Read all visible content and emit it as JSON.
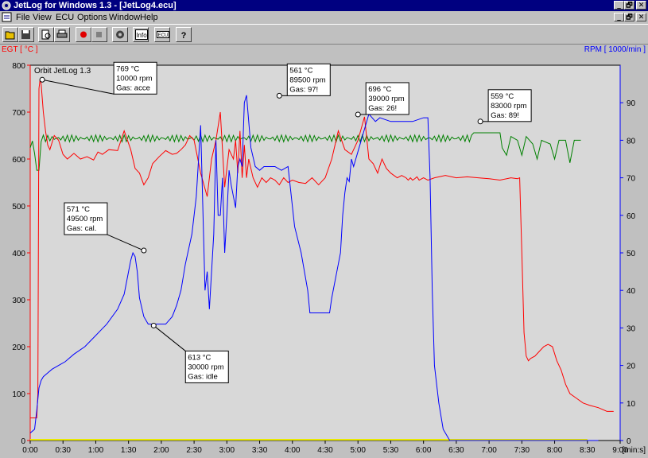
{
  "window": {
    "title": "JetLog for Windows 1.3 - [JetLog4.ecu]",
    "controls": [
      "_",
      "🗗",
      "✕"
    ],
    "doc_controls": [
      "_",
      "🗗",
      "✕"
    ]
  },
  "menu": {
    "items": [
      {
        "label": "File"
      },
      {
        "label": "View"
      },
      {
        "label": "ECU"
      },
      {
        "label": "Options"
      },
      {
        "label": "Window"
      },
      {
        "label": "Help"
      }
    ]
  },
  "toolbar": {
    "buttons": [
      {
        "icon": "open-folder-icon"
      },
      {
        "icon": "save-disk-icon"
      },
      {
        "icon": "print-preview-icon"
      },
      {
        "icon": "print-icon"
      },
      {
        "icon": "record-icon"
      },
      {
        "icon": "stop-icon"
      },
      {
        "icon": "engine-icon"
      },
      {
        "icon": "info-icon",
        "label": "Info"
      },
      {
        "icon": "ecu-icon",
        "label": "ECU"
      },
      {
        "icon": "help-icon",
        "label": "?"
      }
    ]
  },
  "colors": {
    "egt": "#ff0000",
    "rpm": "#0000ff",
    "green": "#008000",
    "yellow": "#e8e800",
    "plot_bg": "#d8d8d8"
  },
  "chart_data": {
    "type": "line",
    "left_axis_label": "EGT [ °C ]",
    "right_axis_label": "RPM [ 1000/min ]",
    "x_unit_label": "[min:s]",
    "logo": "Orbit JetLog 1.3",
    "x_ticks": [
      "0:00",
      "0:30",
      "1:00",
      "1:30",
      "2:00",
      "2:30",
      "3:00",
      "3:30",
      "4:00",
      "4:30",
      "5:00",
      "5:30",
      "6:00",
      "6:30",
      "7:00",
      "7:30",
      "8:00",
      "8:30",
      "9:00"
    ],
    "xlim": [
      0,
      540
    ],
    "ylim_left": [
      0,
      800
    ],
    "ylim_right": [
      0,
      100
    ],
    "left_ticks": [
      "0",
      "100",
      "200",
      "300",
      "400",
      "500",
      "600",
      "700",
      "800"
    ],
    "right_ticks": [
      "0",
      "10",
      "20",
      "30",
      "40",
      "50",
      "60",
      "70",
      "80",
      "90"
    ],
    "series": [
      {
        "axis": "left",
        "x": [
          0,
          6,
          7,
          8,
          9,
          10,
          12,
          14,
          16,
          18,
          22,
          26,
          30,
          34,
          40,
          46,
          52,
          58,
          62,
          66,
          72,
          80,
          86,
          92,
          96,
          100,
          104,
          108,
          112,
          118,
          124,
          130,
          134,
          138,
          142,
          146,
          150,
          156,
          162,
          166,
          170,
          174,
          178,
          182,
          186,
          188,
          190,
          192,
          194,
          196,
          198,
          200,
          204,
          208,
          212,
          216,
          220,
          224,
          228,
          232,
          236,
          240,
          246,
          252,
          258,
          264,
          270,
          276,
          282,
          288,
          294,
          300,
          306,
          310,
          314,
          318,
          322,
          326,
          330,
          336,
          340,
          344,
          346,
          348,
          350,
          352,
          354,
          356,
          360,
          364,
          370,
          380,
          390,
          400,
          410,
          420,
          430,
          440,
          446,
          448,
          450,
          452,
          454,
          456,
          458,
          462,
          466,
          470,
          474,
          478,
          482,
          486,
          490,
          494,
          500,
          506,
          512,
          520,
          528,
          534
        ],
        "y": [
          48,
          48,
          100,
          750,
          769,
          760,
          700,
          660,
          630,
          620,
          650,
          640,
          610,
          600,
          612,
          600,
          605,
          598,
          615,
          610,
          620,
          618,
          660,
          620,
          580,
          570,
          545,
          560,
          590,
          605,
          618,
          610,
          612,
          620,
          630,
          650,
          640,
          570,
          520,
          600,
          640,
          700,
          540,
          620,
          600,
          640,
          570,
          660,
          560,
          630,
          560,
          600,
          560,
          540,
          560,
          550,
          560,
          555,
          545,
          560,
          550,
          555,
          550,
          548,
          560,
          545,
          560,
          600,
          660,
          620,
          610,
          640,
          690,
          600,
          590,
          570,
          600,
          580,
          570,
          560,
          565,
          560,
          555,
          560,
          555,
          558,
          562,
          555,
          560,
          555,
          560,
          565,
          560,
          562,
          560,
          558,
          555,
          560,
          558,
          560,
          400,
          230,
          180,
          170,
          175,
          180,
          190,
          200,
          205,
          200,
          170,
          150,
          120,
          100,
          90,
          80,
          75,
          70,
          62,
          62
        ]
      },
      {
        "axis": "right",
        "x": [
          0,
          4,
          6,
          8,
          10,
          12,
          16,
          20,
          26,
          32,
          40,
          50,
          60,
          70,
          80,
          86,
          90,
          92,
          94,
          96,
          98,
          100,
          104,
          108,
          112,
          116,
          120,
          124,
          130,
          134,
          138,
          142,
          148,
          152,
          156,
          160,
          162,
          164,
          166,
          168,
          170,
          172,
          174,
          176,
          178,
          180,
          182,
          184,
          186,
          188,
          190,
          192,
          194,
          196,
          198,
          200,
          202,
          206,
          210,
          214,
          218,
          224,
          230,
          236,
          242,
          248,
          254,
          256,
          258,
          264,
          270,
          274,
          276,
          280,
          284,
          286,
          288,
          290,
          292,
          294,
          296,
          298,
          300,
          304,
          310,
          316,
          320,
          330,
          340,
          350,
          360,
          364,
          366,
          368,
          370,
          374,
          378,
          382,
          384,
          386,
          390,
          396,
          402,
          408,
          414,
          420,
          426,
          432,
          438,
          444,
          450,
          456,
          460,
          464,
          468,
          472,
          476,
          480,
          484,
          488,
          490,
          492,
          494,
          496,
          498,
          500,
          506,
          512,
          518,
          520
        ],
        "y": [
          2,
          3,
          8,
          14,
          16,
          17,
          18,
          19,
          20,
          21,
          23,
          25,
          28,
          31,
          35,
          39,
          45,
          48,
          50,
          49,
          45,
          38,
          33,
          31,
          31,
          31,
          31,
          31,
          33,
          36,
          40,
          47,
          55,
          65,
          84,
          40,
          45,
          35,
          45,
          55,
          80,
          60,
          60,
          70,
          50,
          60,
          72,
          68,
          65,
          62,
          73,
          75,
          73,
          90,
          92,
          85,
          78,
          73,
          72,
          73,
          73,
          73,
          72,
          73,
          57,
          50,
          40,
          34,
          34,
          34,
          34,
          34,
          38,
          44,
          50,
          60,
          66,
          70,
          69,
          75,
          73,
          75,
          77,
          81,
          87,
          85,
          86,
          85,
          85,
          85,
          86,
          86,
          70,
          40,
          20,
          10,
          3,
          1,
          0,
          0,
          0,
          0,
          0,
          0,
          0,
          0,
          0,
          0,
          0,
          0,
          0,
          0,
          0,
          0,
          0,
          0,
          0,
          0,
          0,
          0,
          0,
          0,
          0,
          0,
          0,
          0,
          0,
          0,
          0,
          0
        ]
      }
    ],
    "annotations": [
      {
        "x": 11,
        "y": 769,
        "lines": [
          "769 °C",
          "10000 rpm",
          "Gas: acce"
        ]
      },
      {
        "x": 104,
        "y": 405,
        "lines": [
          "571 °C",
          "49500 rpm",
          "Gas: cal."
        ]
      },
      {
        "x": 113,
        "y": 245,
        "lines": [
          "613 °C",
          "30000 rpm",
          "Gas: idle"
        ]
      },
      {
        "x": 228,
        "y": 735,
        "lines": [
          "561 °C",
          "89500 rpm",
          "Gas: 97!"
        ]
      },
      {
        "x": 300,
        "y": 695,
        "lines": [
          "696 °C",
          "39000 rpm",
          "Gas: 26!"
        ]
      },
      {
        "x": 412,
        "y": 680,
        "lines": [
          "559 °C",
          "83000 rpm",
          "Gas: 89!"
        ]
      }
    ]
  }
}
